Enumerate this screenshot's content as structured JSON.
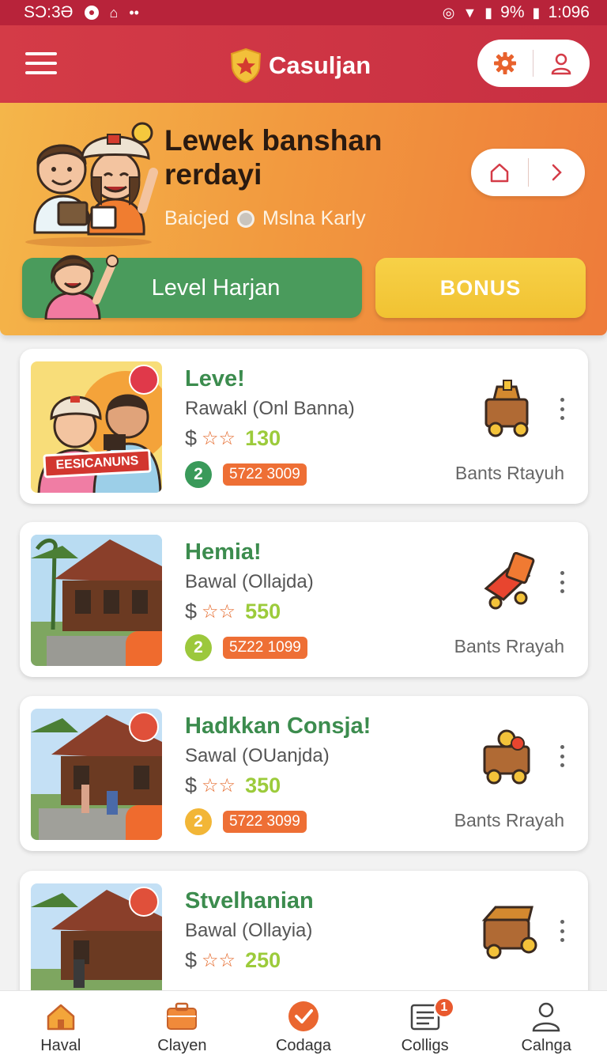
{
  "status_bar": {
    "time": "SƆ:3Ə",
    "battery_text": "9%",
    "clock_right": "1:096"
  },
  "header": {
    "app_name": "Casuljan",
    "settings_icon": "gear-icon",
    "profile_icon": "user-icon",
    "accent_color": "#d43b47"
  },
  "hero": {
    "title": "Lewek banshan rerdayi",
    "sub_left": "Baicjed",
    "sub_right": "Mslna Karly",
    "level_button": "Level Harjan",
    "bonus_button": "BONUS"
  },
  "cards": [
    {
      "title": "Leve!",
      "subtitle": "Rawakl (Onl Banna)",
      "dollar": "$",
      "stars": "☆☆",
      "price": "130",
      "level": "2",
      "level_color": "#3a9a5a",
      "code": "5722 3009",
      "owner": "Bants Rtayuh",
      "thumb_label": "EESICANUNS",
      "icon": "treasure-cart-icon"
    },
    {
      "title": "Hemia!",
      "subtitle": "Bawal (Ollajda)",
      "dollar": "$",
      "stars": "☆☆",
      "price": "550",
      "level": "2",
      "level_color": "#9cc83c",
      "code": "5Z22 1099",
      "owner": "Bants Rrayah",
      "icon": "red-wagon-icon"
    },
    {
      "title": "Hadkkan Consja!",
      "subtitle": "Sawal (OUanjda)",
      "dollar": "$",
      "stars": "☆☆",
      "price": "350",
      "level": "2",
      "level_color": "#f2b637",
      "code": "5722 3099",
      "owner": "Bants Rrayah",
      "icon": "coin-cart-icon"
    },
    {
      "title": "Stvelhanian",
      "subtitle": "Bawal (Ollayia)",
      "dollar": "$",
      "stars": "☆☆",
      "price": "250",
      "icon": "chest-cart-icon"
    }
  ],
  "bottom_nav": [
    {
      "label": "Haval",
      "icon": "home-icon"
    },
    {
      "label": "Clayen",
      "icon": "briefcase-icon"
    },
    {
      "label": "Codaga",
      "icon": "check-circle-icon"
    },
    {
      "label": "Colligs",
      "icon": "list-icon",
      "badge": "1"
    },
    {
      "label": "Calnga",
      "icon": "person-icon"
    }
  ]
}
